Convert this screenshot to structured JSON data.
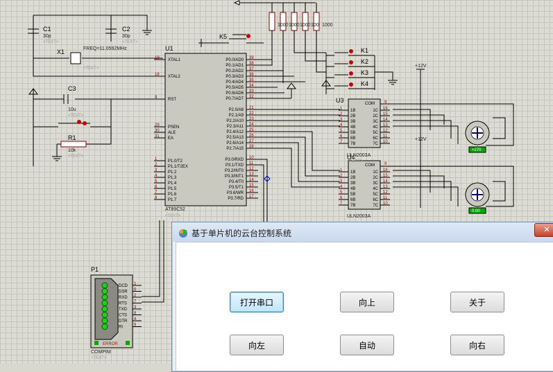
{
  "schematic": {
    "ic_u1": {
      "ref": "U1",
      "part": "AT89C52",
      "tag": "<TEXT>",
      "left_pins": [
        "XTAL1",
        "XTAL2",
        "RST",
        "PSEN",
        "ALE",
        "EA",
        "P1.0/T2",
        "P1.1/T2EX",
        "P1.2",
        "P1.3",
        "P1.4",
        "P1.5",
        "P1.6",
        "P1.7"
      ],
      "left_nums": [
        "19",
        "18",
        "9",
        "29",
        "30",
        "31",
        "1",
        "2",
        "3",
        "4",
        "5",
        "6",
        "7",
        "8"
      ],
      "right_pins": [
        "P0.0/AD0",
        "P0.1/AD1",
        "P0.2/AD2",
        "P0.3/AD3",
        "P0.4/AD4",
        "P0.5/AD5",
        "P0.6/AD6",
        "P0.7/AD7",
        "P2.0/A8",
        "P2.1/A9",
        "P2.2/A10",
        "P2.3/A11",
        "P2.4/A12",
        "P2.5/A13",
        "P2.6/A14",
        "P2.7/A15",
        "P3.0/RXD",
        "P3.1/TXD",
        "P3.2/INT0",
        "P3.3/INT1",
        "P3.4/T0",
        "P3.5/T1",
        "P3.6/WR",
        "P3.7/RD"
      ],
      "right_nums": [
        "39",
        "38",
        "37",
        "36",
        "35",
        "34",
        "33",
        "32",
        "21",
        "22",
        "23",
        "24",
        "25",
        "26",
        "27",
        "28",
        "10",
        "11",
        "12",
        "13",
        "14",
        "15",
        "16",
        "17"
      ]
    },
    "c1": {
      "ref": "C1",
      "value": "30p",
      "tag": "<TEXT>"
    },
    "c2": {
      "ref": "C2",
      "value": "30p",
      "tag": "<TEXT>"
    },
    "x1": {
      "ref": "X1",
      "value": "FREQ=11.0592MHz",
      "tag": "<TEXT>"
    },
    "c3": {
      "ref": "C3",
      "value": "10u",
      "tag": "<TEXT>"
    },
    "r1": {
      "ref": "R1",
      "value": "10k",
      "tag": "<TEXT>"
    },
    "k5": {
      "ref": "K5"
    },
    "keys": [
      "K1",
      "K2",
      "K3",
      "K4"
    ],
    "resistor_values": [
      "1000",
      "1000",
      "1000",
      "100",
      "1000"
    ],
    "u3": {
      "ref": "U3",
      "part": "ULN2003A",
      "tag": "<TEXT>"
    },
    "u4": {
      "ref": "U4",
      "part": "ULN2003A",
      "tag": "<TEXT>"
    },
    "uln_in": [
      "1B",
      "2B",
      "3B",
      "4B",
      "5B",
      "6B",
      "7B"
    ],
    "uln_out": [
      "1C",
      "2C",
      "3C",
      "4C",
      "5C",
      "6C",
      "7C"
    ],
    "uln_com": "COM",
    "uln_in_nums": [
      "1",
      "2",
      "3",
      "4",
      "5",
      "6",
      "7"
    ],
    "uln_out_nums": [
      "16",
      "15",
      "14",
      "13",
      "12",
      "11",
      "10"
    ],
    "uln_com_num": "9",
    "supply": "+12V",
    "motor1_readout": "+270",
    "motor2_readout": "0.00",
    "p1": {
      "ref": "P1",
      "part": "COMPIM",
      "tag": "<TEXT>",
      "error": "ERROR",
      "signals": [
        "DCD",
        "DSR",
        "RXD",
        "RTS",
        "TXD",
        "CTS",
        "DTR",
        "RI"
      ],
      "nums": [
        "1",
        "6",
        "2",
        "7",
        "3",
        "8",
        "4",
        "9"
      ]
    }
  },
  "dialog": {
    "title": "基于单片机的云台控制系统",
    "close_label": "✕",
    "buttons": {
      "open_port": "打开串口",
      "up": "向上",
      "close": "关于",
      "left": "向左",
      "auto": "自动",
      "right": "向右"
    }
  }
}
